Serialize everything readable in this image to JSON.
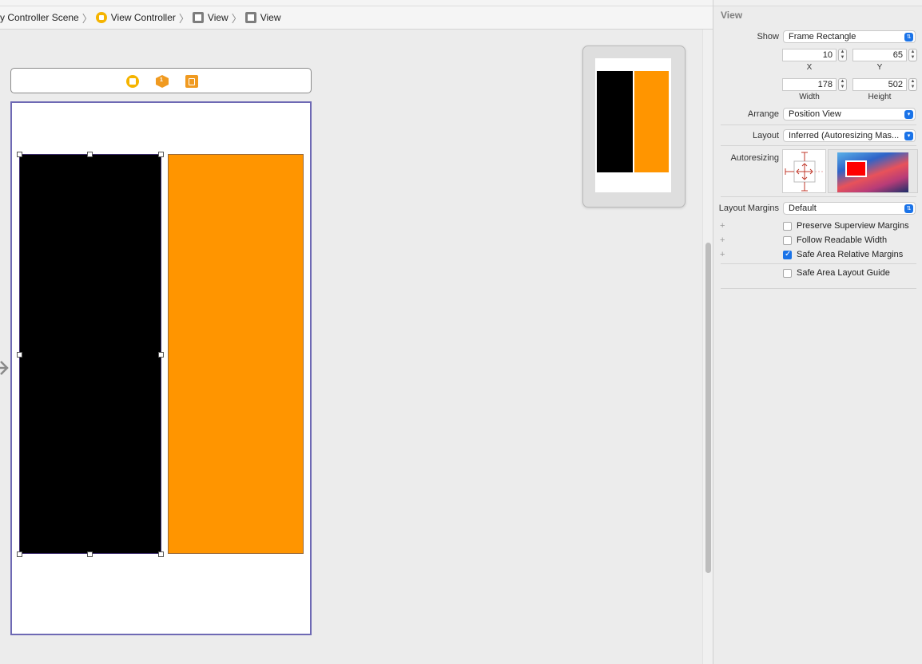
{
  "breadcrumb": {
    "items": [
      {
        "label": "y Controller Scene",
        "icon": "none"
      },
      {
        "label": "View Controller",
        "icon": "view-controller-icon"
      },
      {
        "label": "View",
        "icon": "view-icon"
      },
      {
        "label": "View",
        "icon": "view-icon"
      }
    ]
  },
  "canvas": {
    "scene_dock_icons": [
      "view-controller-icon",
      "first-responder-icon",
      "exit-icon"
    ],
    "black_view_color": "#000000",
    "orange_view_color": "#FF9500",
    "selection_color": "#6E69B4"
  },
  "inspector": {
    "title": "View",
    "show": {
      "label": "Show",
      "value": "Frame Rectangle"
    },
    "frame": {
      "x": {
        "value": "10",
        "caption": "X"
      },
      "y": {
        "value": "65",
        "caption": "Y"
      },
      "width": {
        "value": "178",
        "caption": "Width"
      },
      "height": {
        "value": "502",
        "caption": "Height"
      }
    },
    "arrange": {
      "label": "Arrange",
      "value": "Position View"
    },
    "layout": {
      "label": "Layout",
      "value": "Inferred (Autoresizing Mas..."
    },
    "autoresizing": {
      "label": "Autoresizing"
    },
    "layout_margins": {
      "label": "Layout Margins",
      "value": "Default"
    },
    "checkboxes": [
      {
        "label": "Preserve Superview Margins",
        "checked": false
      },
      {
        "label": "Follow Readable Width",
        "checked": false
      },
      {
        "label": "Safe Area Relative Margins",
        "checked": true
      },
      {
        "label": "Safe Area Layout Guide",
        "checked": false
      }
    ]
  }
}
